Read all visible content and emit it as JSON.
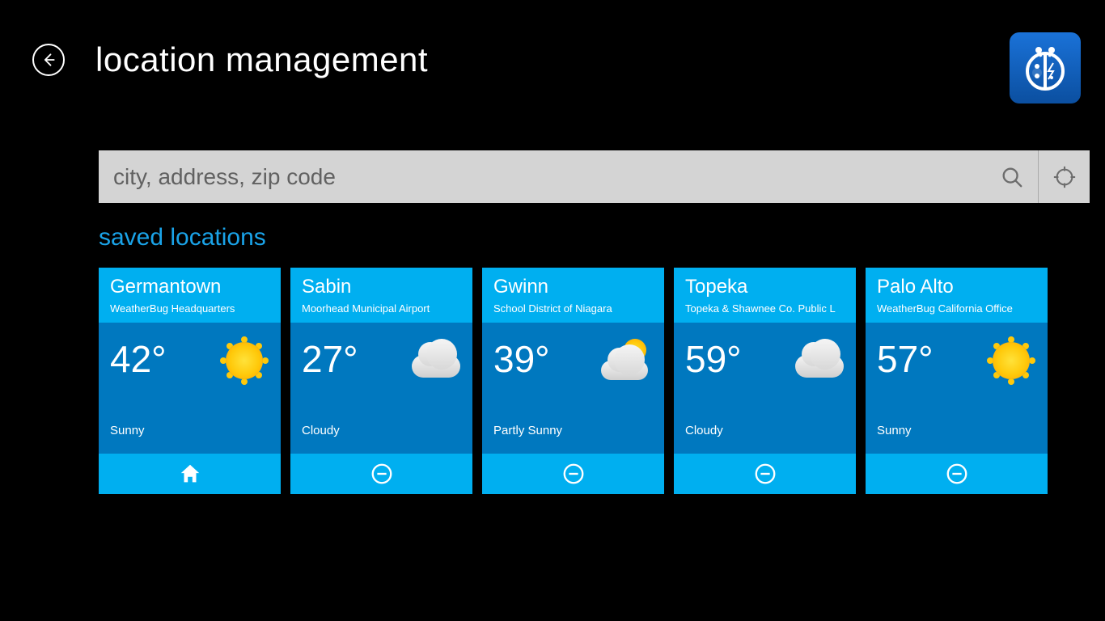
{
  "header": {
    "title": "location management"
  },
  "search": {
    "placeholder": "city, address, zip code"
  },
  "section": {
    "title": "saved locations"
  },
  "icons": {
    "sunny": "sunny",
    "cloudy": "cloudy",
    "partly_sunny": "partly-sunny"
  },
  "locations": [
    {
      "city": "Germantown",
      "station": "WeatherBug Headquarters",
      "temp": "42°",
      "condition": "Sunny",
      "icon": "sunny",
      "is_home": true
    },
    {
      "city": "Sabin",
      "station": "Moorhead Municipal Airport",
      "temp": "27°",
      "condition": "Cloudy",
      "icon": "cloudy",
      "is_home": false
    },
    {
      "city": "Gwinn",
      "station": "School District of Niagara",
      "temp": "39°",
      "condition": "Partly Sunny",
      "icon": "partly-sunny",
      "is_home": false
    },
    {
      "city": "Topeka",
      "station": "Topeka & Shawnee Co. Public L",
      "temp": "59°",
      "condition": "Cloudy",
      "icon": "cloudy",
      "is_home": false
    },
    {
      "city": "Palo Alto",
      "station": "WeatherBug California Office",
      "temp": "57°",
      "condition": "Sunny",
      "icon": "sunny",
      "is_home": false
    }
  ]
}
